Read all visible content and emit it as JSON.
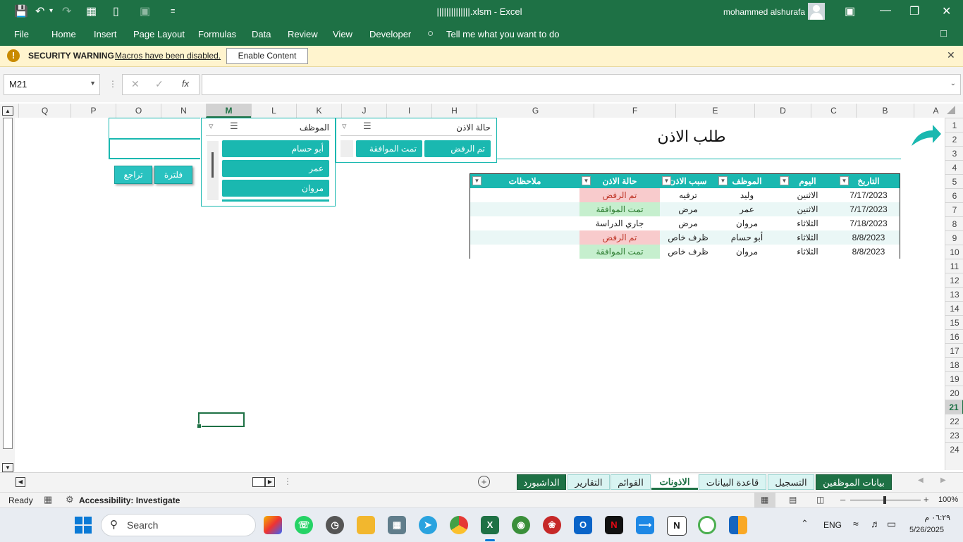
{
  "window": {
    "file_title": "||||||||||||||.xlsm",
    "app_name": "Excel",
    "title_sep": "-",
    "user_name": "mohammed alshurafa"
  },
  "menu": {
    "items": [
      "File",
      "Home",
      "Insert",
      "Page Layout",
      "Formulas",
      "Data",
      "Review",
      "View",
      "Developer"
    ],
    "tell_me": "Tell me what you want to do"
  },
  "security_bar": {
    "label": "SECURITY WARNING",
    "message": "Macros have been disabled.",
    "button": "Enable Content"
  },
  "formula_bar": {
    "name_box": "M21",
    "fx": "fx",
    "content": ""
  },
  "columns": [
    {
      "label": "Q",
      "sel": false
    },
    {
      "label": "P",
      "sel": false
    },
    {
      "label": "O",
      "sel": false
    },
    {
      "label": "N",
      "sel": false
    },
    {
      "label": "M",
      "sel": true
    },
    {
      "label": "L",
      "sel": false
    },
    {
      "label": "K",
      "sel": false
    },
    {
      "label": "J",
      "sel": false
    },
    {
      "label": "I",
      "sel": false
    },
    {
      "label": "H",
      "sel": false
    },
    {
      "label": "G",
      "sel": false
    },
    {
      "label": "F",
      "sel": false
    },
    {
      "label": "E",
      "sel": false
    },
    {
      "label": "D",
      "sel": false
    },
    {
      "label": "C",
      "sel": false
    },
    {
      "label": "B",
      "sel": false
    },
    {
      "label": "A",
      "sel": false
    }
  ],
  "rows": [
    "1",
    "2",
    "3",
    "4",
    "5",
    "6",
    "7",
    "8",
    "9",
    "10",
    "11",
    "12",
    "13",
    "14",
    "15",
    "16",
    "17",
    "18",
    "19",
    "20",
    "21",
    "22",
    "23",
    "24"
  ],
  "selected_row": "21",
  "sheet": {
    "title": "طلب الاذن",
    "table": {
      "headers": [
        "التاريخ",
        "اليوم",
        "الموظف",
        "سبب الاذن",
        "حالة الاذن",
        "ملاحظات"
      ],
      "rows": [
        [
          "7/17/2023",
          "الاثنين",
          "وليد",
          "ترفيه",
          "تم الرفض",
          ""
        ],
        [
          "7/17/2023",
          "الاثنين",
          "عمر",
          "مرض",
          "تمت الموافقة",
          ""
        ],
        [
          "7/18/2023",
          "الثلاثاء",
          "مروان",
          "مرض",
          "جاري الدراسة",
          ""
        ],
        [
          "8/8/2023",
          "الثلاثاء",
          "أبو حسام",
          "ظرف خاص",
          "تم الرفض",
          ""
        ],
        [
          "8/8/2023",
          "الثلاثاء",
          "مروان",
          "ظرف خاص",
          "تمت الموافقة",
          ""
        ]
      ],
      "status_colors": {
        "تم الرفض": {
          "bg": "#f8cbcc",
          "fg": "#c0392b"
        },
        "تمت الموافقة": {
          "bg": "#c6efce",
          "fg": "#2e7d32"
        },
        "جاري الدراسة": {
          "bg": "#ffffff",
          "fg": "#222222"
        }
      }
    },
    "slicer_status": {
      "title": "حالة الاذن",
      "items": [
        "تم الرفض",
        "تمت الموافقة"
      ]
    },
    "slicer_employee": {
      "title": "الموظف",
      "items": [
        "أبو حسام",
        "عمر",
        "مروان"
      ]
    },
    "buttons": {
      "filter": "فلترة",
      "undo": "تراجع"
    }
  },
  "tabs": [
    {
      "label": "بيانات الموظفين",
      "style": "green"
    },
    {
      "label": "التسجيل",
      "style": "teal"
    },
    {
      "label": "قاعدة البيانات",
      "style": "teal"
    },
    {
      "label": "الاذونات",
      "style": "active"
    },
    {
      "label": "القوائم",
      "style": "teal"
    },
    {
      "label": "التقارير",
      "style": "teal"
    },
    {
      "label": "الداشبورد",
      "style": "green"
    }
  ],
  "status_bar": {
    "ready": "Ready",
    "accessibility": "Accessibility: Investigate",
    "zoom": "100%"
  },
  "taskbar": {
    "search": "Search",
    "lang": "ENG",
    "time": "٠٦:٢٩ م",
    "date": "5/26/2025"
  },
  "colors": {
    "excel_green": "#1e7145",
    "teal": "#1ab8b0",
    "warning_bg": "#fff4ce"
  }
}
